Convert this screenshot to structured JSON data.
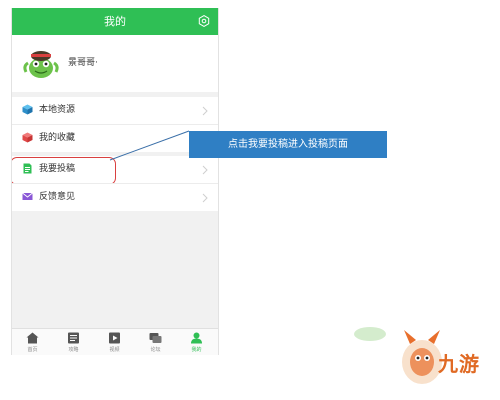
{
  "app": {
    "title": "我的"
  },
  "profile": {
    "username": "景哥哥·"
  },
  "menu": {
    "items": [
      {
        "label": "本地资源",
        "icon": "cube-icon"
      },
      {
        "label": "我的收藏",
        "icon": "favorite-box-icon"
      },
      {
        "label": "我要投稿",
        "icon": "document-icon"
      },
      {
        "label": "反馈意见",
        "icon": "mail-icon"
      }
    ]
  },
  "bottom_nav": {
    "items": [
      {
        "label": "首页",
        "icon": "home-icon"
      },
      {
        "label": "攻略",
        "icon": "guide-icon"
      },
      {
        "label": "视频",
        "icon": "video-icon"
      },
      {
        "label": "论坛",
        "icon": "forum-icon"
      },
      {
        "label": "我的",
        "icon": "user-icon",
        "active": true
      }
    ]
  },
  "annotation": {
    "text": "点击我要投稿进入投稿页面"
  },
  "watermark": {
    "text": "九游"
  },
  "colors": {
    "brand_green": "#2fbf55",
    "callout_blue": "#2f7fc4",
    "highlight_red": "#d94040",
    "logo_orange": "#e06a24"
  }
}
